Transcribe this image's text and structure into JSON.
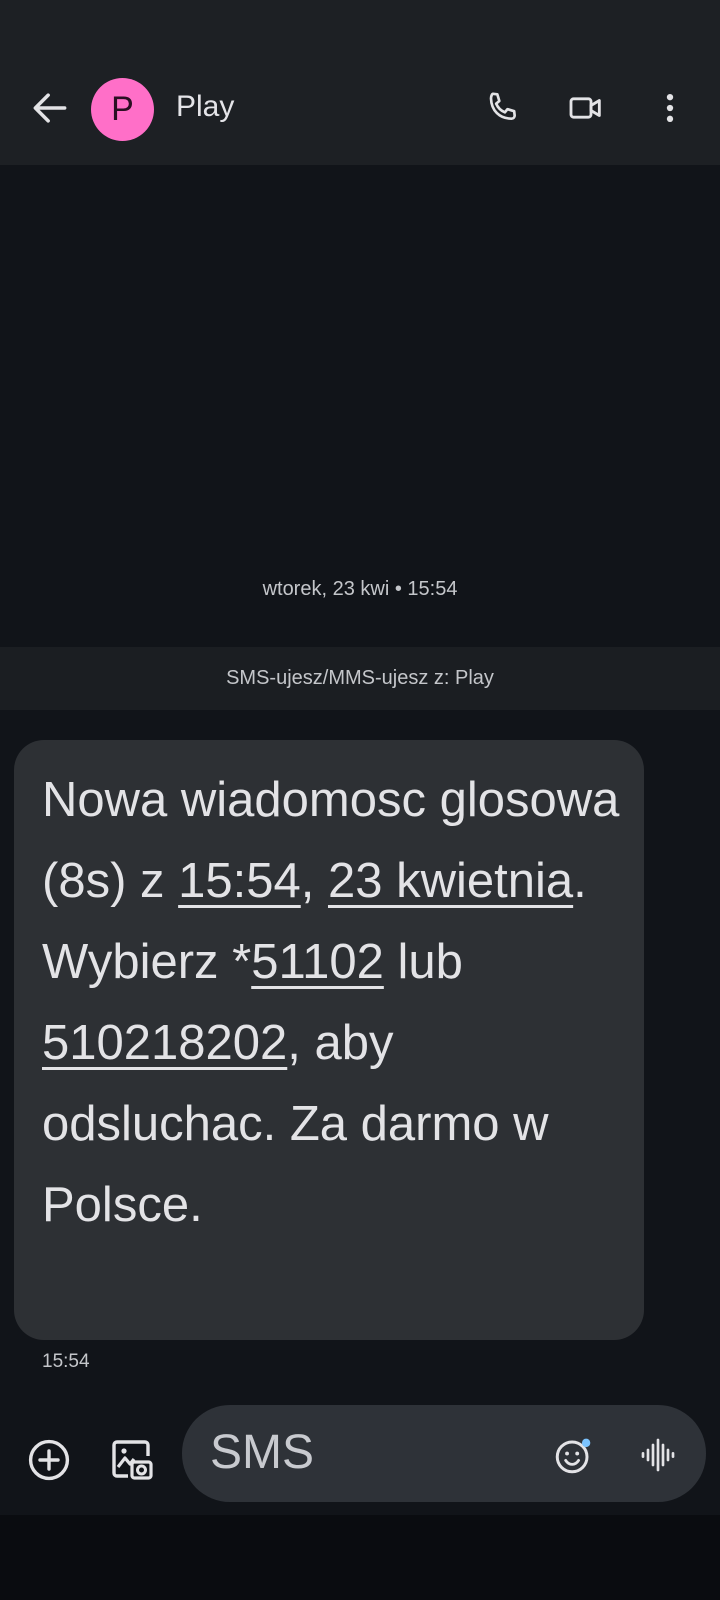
{
  "header": {
    "back_icon": "arrow-back-icon",
    "avatar_letter": "P",
    "avatar_color": "#ff6fc8",
    "contact_name": "Play",
    "call_icon": "phone-icon",
    "video_icon": "video-camera-icon",
    "more_icon": "more-vert-icon"
  },
  "conversation": {
    "date_separator": "wtorek, 23 kwi • 15:54",
    "sim_info": "SMS-ujesz/MMS-ujesz z: Play",
    "message": {
      "p1": "Nowa wiadomosc glosowa (8s) z ",
      "link_time": "15:54",
      "p2": ", ",
      "link_date": "23 kwietnia",
      "p3": ". Wybierz *",
      "link_code": "51102",
      "p4": " lub ",
      "link_number": "510218202",
      "p5": ", aby odsluchac. Za darmo w Polsce."
    },
    "message_time": "15:54"
  },
  "composer": {
    "add_icon": "add-circle-icon",
    "gallery_icon": "gallery-icon",
    "placeholder": "SMS",
    "emoji_icon": "emoji-icon",
    "voice_icon": "voice-icon",
    "accent": "#7cc4ff"
  }
}
